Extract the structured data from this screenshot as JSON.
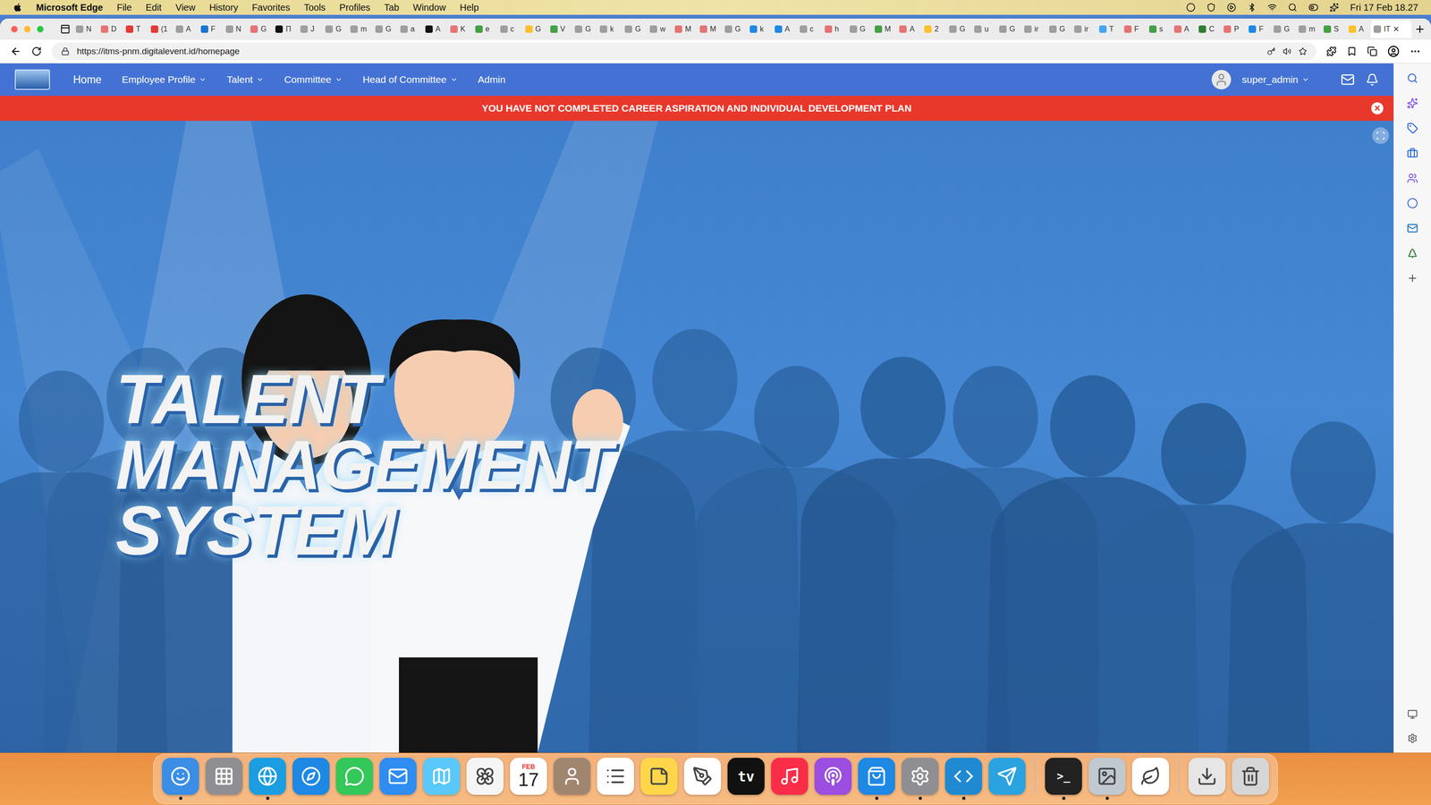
{
  "menubar": {
    "app": "Microsoft Edge",
    "menus": [
      "File",
      "Edit",
      "View",
      "History",
      "Favorites",
      "Tools",
      "Profiles",
      "Tab",
      "Window",
      "Help"
    ],
    "clock": "Fri 17 Feb 18.27"
  },
  "tabs": [
    {
      "label": "N",
      "color": "#9e9e9e",
      "selected": false
    },
    {
      "label": "D",
      "color": "#e57373",
      "selected": false
    },
    {
      "label": "T",
      "color": "#e53935",
      "selected": false
    },
    {
      "label": "(1",
      "color": "#e53935",
      "selected": false
    },
    {
      "label": "A",
      "color": "#9e9e9e",
      "selected": false
    },
    {
      "label": "F",
      "color": "#1976d2",
      "selected": false
    },
    {
      "label": "N",
      "color": "#9e9e9e",
      "selected": false
    },
    {
      "label": "G",
      "color": "#e57373",
      "selected": false
    },
    {
      "label": "Π",
      "color": "#111111",
      "selected": false
    },
    {
      "label": "J",
      "color": "#9e9e9e",
      "selected": false
    },
    {
      "label": "G",
      "color": "#9e9e9e",
      "selected": false
    },
    {
      "label": "m",
      "color": "#9e9e9e",
      "selected": false
    },
    {
      "label": "G",
      "color": "#9e9e9e",
      "selected": false
    },
    {
      "label": "a",
      "color": "#9e9e9e",
      "selected": false
    },
    {
      "label": "A",
      "color": "#111111",
      "selected": false
    },
    {
      "label": "K",
      "color": "#e57373",
      "selected": false
    },
    {
      "label": "e",
      "color": "#43a047",
      "selected": false
    },
    {
      "label": "c",
      "color": "#9e9e9e",
      "selected": false
    },
    {
      "label": "G",
      "color": "#fbc02d",
      "selected": false
    },
    {
      "label": "V",
      "color": "#43a047",
      "selected": false
    },
    {
      "label": "G",
      "color": "#9e9e9e",
      "selected": false
    },
    {
      "label": "k",
      "color": "#9e9e9e",
      "selected": false
    },
    {
      "label": "G",
      "color": "#9e9e9e",
      "selected": false
    },
    {
      "label": "w",
      "color": "#9e9e9e",
      "selected": false
    },
    {
      "label": "M",
      "color": "#e57373",
      "selected": false
    },
    {
      "label": "M",
      "color": "#e57373",
      "selected": false
    },
    {
      "label": "G",
      "color": "#9e9e9e",
      "selected": false
    },
    {
      "label": "k",
      "color": "#1e88e5",
      "selected": false
    },
    {
      "label": "A",
      "color": "#1e88e5",
      "selected": false
    },
    {
      "label": "c",
      "color": "#9e9e9e",
      "selected": false
    },
    {
      "label": "h",
      "color": "#e57373",
      "selected": false
    },
    {
      "label": "G",
      "color": "#9e9e9e",
      "selected": false
    },
    {
      "label": "M",
      "color": "#43a047",
      "selected": false
    },
    {
      "label": "A",
      "color": "#e57373",
      "selected": false
    },
    {
      "label": "2",
      "color": "#fbc02d",
      "selected": false
    },
    {
      "label": "G",
      "color": "#9e9e9e",
      "selected": false
    },
    {
      "label": "u",
      "color": "#9e9e9e",
      "selected": false
    },
    {
      "label": "G",
      "color": "#9e9e9e",
      "selected": false
    },
    {
      "label": "ir",
      "color": "#9e9e9e",
      "selected": false
    },
    {
      "label": "G",
      "color": "#9e9e9e",
      "selected": false
    },
    {
      "label": "ir",
      "color": "#9e9e9e",
      "selected": false
    },
    {
      "label": "T",
      "color": "#42a5f5",
      "selected": false
    },
    {
      "label": "F",
      "color": "#e57373",
      "selected": false
    },
    {
      "label": "s",
      "color": "#43a047",
      "selected": false
    },
    {
      "label": "A",
      "color": "#e57373",
      "selected": false
    },
    {
      "label": "C",
      "color": "#2e7d32",
      "selected": false
    },
    {
      "label": "P",
      "color": "#e57373",
      "selected": false
    },
    {
      "label": "F",
      "color": "#1e88e5",
      "selected": false
    },
    {
      "label": "G",
      "color": "#9e9e9e",
      "selected": false
    },
    {
      "label": "m",
      "color": "#9e9e9e",
      "selected": false
    },
    {
      "label": "S",
      "color": "#43a047",
      "selected": false
    },
    {
      "label": "A",
      "color": "#fbc02d",
      "selected": false
    },
    {
      "label": "IT",
      "color": "#9e9e9e",
      "selected": true
    }
  ],
  "tab_close": "×",
  "address_bar": {
    "url": "https://itms-pnm.digitalevent.id/homepage"
  },
  "nav": {
    "items": [
      {
        "label": "Home",
        "dropdown": false,
        "selected": true
      },
      {
        "label": "Employee Profile",
        "dropdown": true,
        "selected": false
      },
      {
        "label": "Talent",
        "dropdown": true,
        "selected": false
      },
      {
        "label": "Committee",
        "dropdown": true,
        "selected": false
      },
      {
        "label": "Head of Committee",
        "dropdown": true,
        "selected": false
      },
      {
        "label": "Admin",
        "dropdown": false,
        "selected": false
      }
    ],
    "user": "super_admin"
  },
  "banner": {
    "text": "YOU HAVE NOT COMPLETED CAREER ASPIRATION AND INDIVIDUAL DEVELOPMENT PLAN",
    "close": "×"
  },
  "hero": {
    "title": [
      "TALENT",
      "MANAGEMENT",
      "SYSTEM"
    ]
  },
  "dock": {
    "items": [
      {
        "kind": "finder",
        "color": "#3a8ee6",
        "running": true,
        "labels": []
      },
      {
        "kind": "launchpad",
        "color": "#8e8e93",
        "running": false,
        "labels": []
      },
      {
        "kind": "edge",
        "color": "#1b9de2",
        "running": true,
        "labels": []
      },
      {
        "kind": "safari",
        "color": "#1e88e5",
        "running": false,
        "labels": []
      },
      {
        "kind": "messages",
        "color": "#34c759",
        "running": false,
        "labels": []
      },
      {
        "kind": "mail",
        "color": "#2f8cf0",
        "running": false,
        "labels": []
      },
      {
        "kind": "maps",
        "color": "#5ac8fa",
        "running": false,
        "labels": []
      },
      {
        "kind": "photos",
        "color": "#f5f5f5",
        "running": false,
        "labels": []
      },
      {
        "kind": "calendar",
        "color": "#ffffff",
        "running": false,
        "labels": [
          "FEB",
          "17"
        ]
      },
      {
        "kind": "contacts",
        "color": "#a1866f",
        "running": false,
        "labels": []
      },
      {
        "kind": "reminders",
        "color": "#ffffff",
        "running": false,
        "labels": []
      },
      {
        "kind": "notes",
        "color": "#ffd54a",
        "running": false,
        "labels": []
      },
      {
        "kind": "freeform",
        "color": "#ffffff",
        "running": false,
        "labels": []
      },
      {
        "kind": "tv",
        "color": "#111111",
        "running": false,
        "labels": [
          "tv"
        ]
      },
      {
        "kind": "music",
        "color": "#fa2d48",
        "running": false,
        "labels": []
      },
      {
        "kind": "podcasts",
        "color": "#9b4ee0",
        "running": false,
        "labels": []
      },
      {
        "kind": "appstore",
        "color": "#1e88e5",
        "running": true,
        "labels": []
      },
      {
        "kind": "settings",
        "color": "#8e8e93",
        "running": true,
        "labels": []
      },
      {
        "kind": "vscode",
        "color": "#1f8ad2",
        "running": true,
        "labels": []
      },
      {
        "kind": "telegram",
        "color": "#2aa3e0",
        "running": false,
        "labels": []
      },
      {
        "kind": "separator",
        "color": "#bbbbbb",
        "running": false,
        "labels": []
      },
      {
        "kind": "terminal",
        "color": "#222222",
        "running": true,
        "labels": [
          ">_"
        ]
      },
      {
        "kind": "preview",
        "color": "#c0c8d0",
        "running": true,
        "labels": []
      },
      {
        "kind": "mongodb",
        "color": "#ffffff",
        "running": false,
        "labels": []
      },
      {
        "kind": "separator",
        "color": "#bbbbbb",
        "running": false,
        "labels": []
      },
      {
        "kind": "downloads",
        "color": "#e6e6e6",
        "running": false,
        "labels": []
      },
      {
        "kind": "trash",
        "color": "#d6d6d6",
        "running": false,
        "labels": []
      }
    ]
  }
}
